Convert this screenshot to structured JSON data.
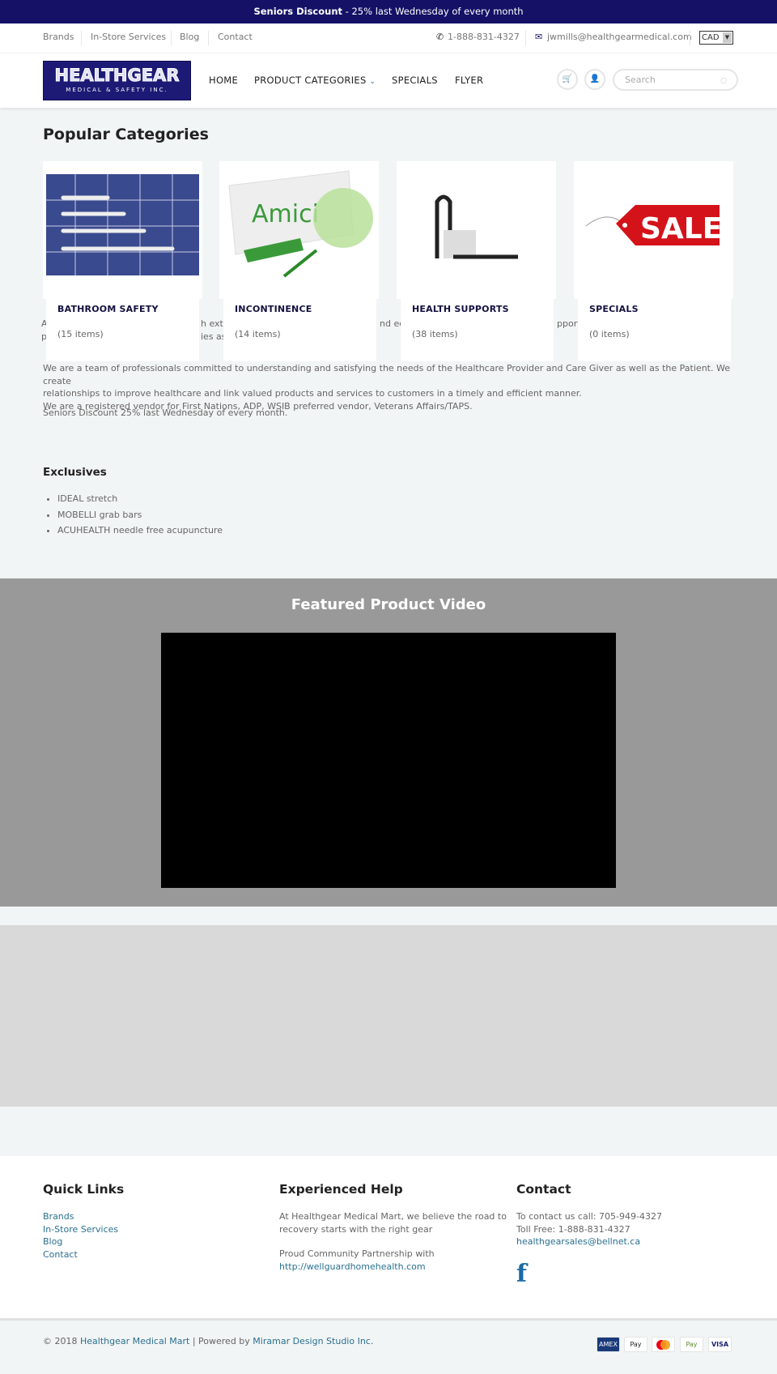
{
  "banner": {
    "bold": "Seniors Discount",
    "rest": " - 25% last Wednesday of every month"
  },
  "topbar": {
    "links": [
      "Brands",
      "In-Store Services",
      "Blog",
      "Contact"
    ],
    "phone": "1-888-831-4327",
    "email": "jwmills@healthgearmedical.com",
    "currency": "CAD"
  },
  "header": {
    "logo_main": "HEALTHGEAR",
    "logo_sub": "MEDICAL & SAFETY INC.",
    "nav": [
      "HOME",
      "PRODUCT CATEGORIES",
      "SPECIALS",
      "FLYER"
    ],
    "search_placeholder": "Search"
  },
  "categories": {
    "title": "Popular Categories",
    "items": [
      {
        "name": "BATHROOM SAFETY",
        "count": "(15 items)"
      },
      {
        "name": "INCONTINENCE",
        "count": "(14 items)"
      },
      {
        "name": "HEALTH SUPPORTS",
        "count": "(38 items)"
      },
      {
        "name": "SPECIALS",
        "count": "(0 items)"
      }
    ]
  },
  "about": {
    "fragments": [
      "A",
      "h exte",
      "nd equ",
      "pports",
      "p",
      "ies as"
    ],
    "line1": "We are a team of professionals committed to understanding and satisfying the needs of the Healthcare Provider and Care Giver as well as the Patient. We create",
    "line2": "relationships to improve healthcare and link valued products and services to customers in a timely and efficient manner.",
    "line3": "We are a registered vendor for First Nations, ADP, WSIB preferred vendor, Veterans Affairs/TAPS.",
    "line4": "Seniors Discount 25% last Wednesday of every month."
  },
  "exclusives": {
    "title": "Exclusives",
    "items": [
      "IDEAL stretch",
      "MOBELLI grab bars",
      "ACUHEALTH needle free acupuncture"
    ]
  },
  "video": {
    "title": "Featured Product Video"
  },
  "footer": {
    "quick": {
      "title": "Quick Links",
      "links": [
        "Brands",
        "In-Store Services",
        "Blog",
        "Contact"
      ]
    },
    "help": {
      "title": "Experienced Help",
      "text1": "At Healthgear Medical Mart, we believe the road to",
      "text2": "recovery starts with the right gear",
      "text3": "Proud Community Partnership with",
      "link": "http://wellguardhomehealth.com"
    },
    "contact": {
      "title": "Contact",
      "line1": "To contact us call: 705-949-4327",
      "line2": "Toll Free: 1-888-831-4327",
      "email": "healthgearsales@bellnet.ca"
    }
  },
  "bottom": {
    "copy": "© 2018 ",
    "store": "Healthgear Medical Mart",
    "powered": " | Powered by ",
    "studio": "Miramar Design Studio Inc.",
    "payments": [
      "AMEX",
      "Pay",
      "",
      "Pay",
      "VISA"
    ]
  },
  "colors": {
    "brand": "#141166",
    "link": "#2a7090",
    "video_bg": "#999999"
  }
}
